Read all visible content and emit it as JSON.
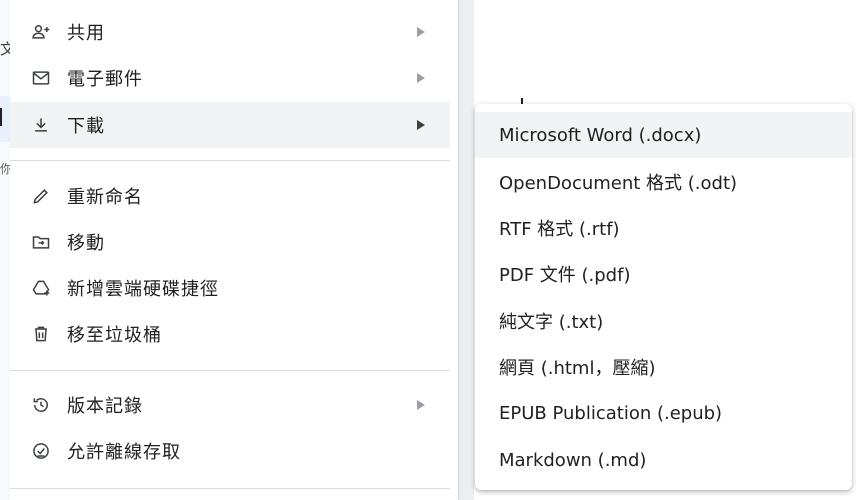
{
  "background": {
    "left_fragments": [
      "文",
      "你"
    ]
  },
  "main_menu": {
    "items": [
      {
        "label": "共用",
        "icon": "person-add-icon",
        "has_submenu": true
      },
      {
        "label": "電子郵件",
        "icon": "mail-icon",
        "has_submenu": true
      },
      {
        "label": "下載",
        "icon": "download-icon",
        "has_submenu": true,
        "highlighted": true
      },
      {
        "label": "重新命名",
        "icon": "pencil-icon",
        "has_submenu": false
      },
      {
        "label": "移動",
        "icon": "move-folder-icon",
        "has_submenu": false
      },
      {
        "label": "新增雲端硬碟捷徑",
        "icon": "drive-shortcut-icon",
        "has_submenu": false
      },
      {
        "label": "移至垃圾桶",
        "icon": "trash-icon",
        "has_submenu": false
      },
      {
        "label": "版本記錄",
        "icon": "history-icon",
        "has_submenu": true
      },
      {
        "label": "允許離線存取",
        "icon": "offline-check-icon",
        "has_submenu": false
      }
    ]
  },
  "download_submenu": {
    "items": [
      {
        "label": "Microsoft Word (.docx)",
        "highlighted": true
      },
      {
        "label": "OpenDocument 格式 (.odt)"
      },
      {
        "label": "RTF 格式 (.rtf)"
      },
      {
        "label": "PDF 文件 (.pdf)"
      },
      {
        "label": "純文字 (.txt)"
      },
      {
        "label": "網頁 (.html，壓縮)"
      },
      {
        "label": "EPUB Publication (.epub)"
      },
      {
        "label": "Markdown (.md)"
      }
    ]
  }
}
